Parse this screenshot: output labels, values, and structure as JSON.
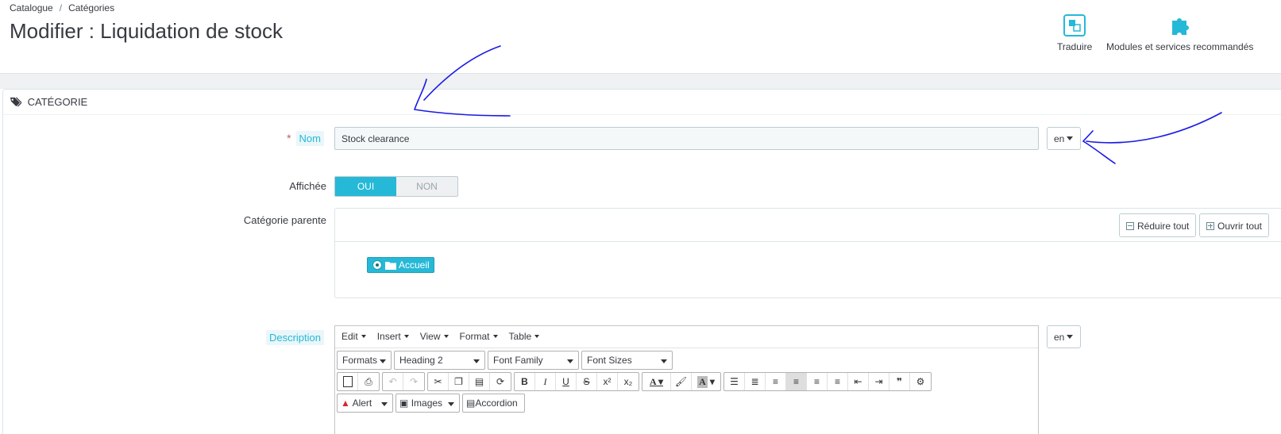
{
  "breadcrumb": {
    "item1": "Catalogue",
    "separator": "/",
    "item2": "Catégories"
  },
  "page": {
    "title": "Modifier : Liquidation de stock"
  },
  "toolbar": {
    "translate_label": "Traduire",
    "modules_label": "Modules et services recommandés"
  },
  "panel": {
    "heading": "CATÉGORIE"
  },
  "form": {
    "name_label": "Nom",
    "name_required": "*",
    "name_value": "Stock clearance",
    "name_lang": "en",
    "displayed_label": "Affichée",
    "displayed_on": "OUI",
    "displayed_off": "NON",
    "parent_label": "Catégorie parente",
    "collapse_all": "Réduire tout",
    "expand_all": "Ouvrir tout",
    "tree_root": "Accueil",
    "description_label": "Description",
    "description_lang": "en"
  },
  "editor": {
    "menus": [
      "Edit",
      "Insert",
      "View",
      "Format",
      "Table"
    ],
    "formats": "Formats",
    "heading": "Heading 2",
    "font_family": "Font Family",
    "font_sizes": "Font Sizes",
    "alert": "Alert",
    "images": "Images",
    "accordion": "Accordion"
  },
  "colors": {
    "accent": "#25b9d7",
    "annotation": "#1a1ae6",
    "required": "#c05c67"
  }
}
